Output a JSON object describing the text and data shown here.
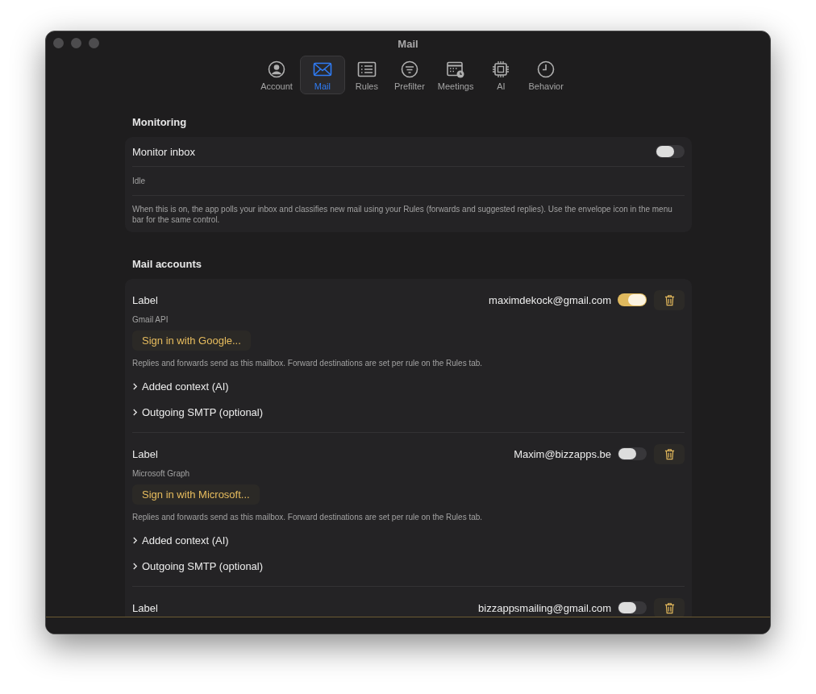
{
  "window": {
    "title": "Mail"
  },
  "tabs": [
    {
      "label": "Account",
      "selected": false
    },
    {
      "label": "Mail",
      "selected": true
    },
    {
      "label": "Rules",
      "selected": false
    },
    {
      "label": "Prefilter",
      "selected": false
    },
    {
      "label": "Meetings",
      "selected": false
    },
    {
      "label": "AI",
      "selected": false
    },
    {
      "label": "Behavior",
      "selected": false
    }
  ],
  "monitoring": {
    "heading": "Monitoring",
    "toggle_label": "Monitor inbox",
    "on": false,
    "status": "Idle",
    "description": "When this is on, the app polls your inbox and classifies new mail using your Rules (forwards and suggested replies). Use the envelope icon in the menu bar for the same control."
  },
  "mail_accounts": {
    "heading": "Mail accounts",
    "accounts": [
      {
        "label": "Label",
        "email": "maximdekock@gmail.com",
        "enabled": true,
        "provider": "Gmail API",
        "sign_in_button": "Sign in with Google...",
        "note": "Replies and forwards send as this mailbox. Forward destinations are set per rule on the Rules tab.",
        "sections": [
          {
            "label": "Added context (AI)",
            "expanded": false
          },
          {
            "label": "Outgoing SMTP (optional)",
            "expanded": false
          }
        ]
      },
      {
        "label": "Label",
        "email": "Maxim@bizzapps.be",
        "enabled": false,
        "provider": "Microsoft Graph",
        "sign_in_button": "Sign in with Microsoft...",
        "note": "Replies and forwards send as this mailbox. Forward destinations are set per rule on the Rules tab.",
        "sections": [
          {
            "label": "Added context (AI)",
            "expanded": false
          },
          {
            "label": "Outgoing SMTP (optional)",
            "expanded": false
          }
        ]
      },
      {
        "label": "Label",
        "email": "bizzappsmailing@gmail.com",
        "enabled": false
      }
    ]
  }
}
